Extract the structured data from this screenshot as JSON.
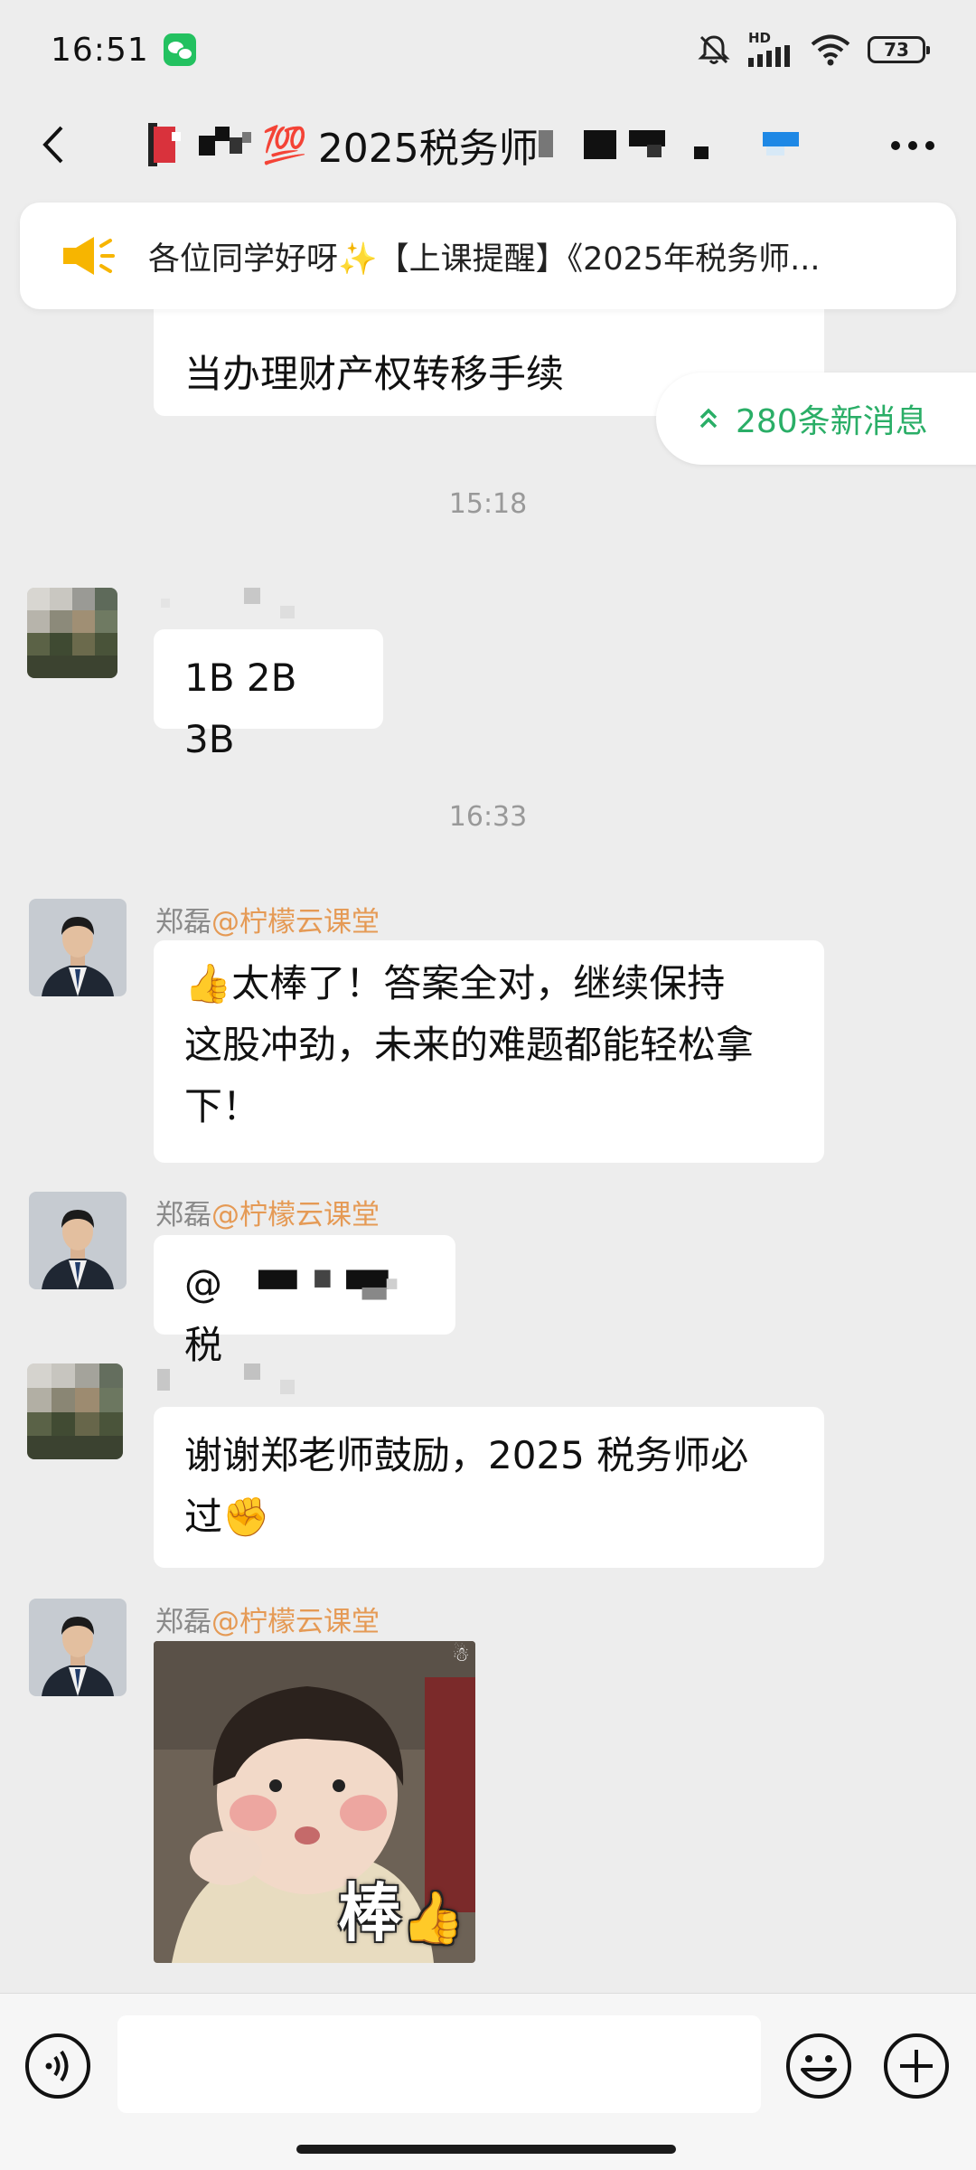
{
  "status_bar": {
    "time": "16:51",
    "network_label": "HD",
    "battery_level": "73"
  },
  "header": {
    "title_text": "2025税务师",
    "title_emoji": "💯"
  },
  "announcement": {
    "text": "各位同学好呀✨【上课提醒】《2025年税务师..."
  },
  "new_messages": {
    "label": "280条新消息"
  },
  "messages": [
    {
      "type": "text",
      "text": "当办理财产权转移手续"
    },
    {
      "type": "time",
      "text": "15:18"
    },
    {
      "type": "text",
      "text": "1B 2B 3B"
    },
    {
      "type": "time",
      "text": "16:33"
    },
    {
      "type": "text",
      "sender": "郑磊",
      "sender_org": "@柠檬云课堂",
      "emoji": "👍",
      "text_lines": [
        "太棒了！答案全对，继续保持",
        "这股冲劲，未来的难题都能轻松拿",
        "下！"
      ]
    },
    {
      "type": "text",
      "sender": "郑磊",
      "sender_org": "@柠檬云课堂",
      "text": "@税"
    },
    {
      "type": "text",
      "text_lines": [
        "谢谢郑老师鼓励，2025 税务师必",
        "过"
      ],
      "emoji": "✊"
    },
    {
      "type": "sticker",
      "sender": "郑磊",
      "sender_org": "@柠檬云课堂",
      "caption": "棒",
      "caption_emoji": "👍"
    }
  ],
  "colors": {
    "accent_green": "#2aae67",
    "sender_org": "#e59a55",
    "background": "#ededed"
  },
  "icons": [
    "back-icon",
    "more-icon",
    "megaphone-icon",
    "voice-icon",
    "emoji-icon",
    "plus-icon",
    "mute-bell-icon",
    "signal-icon",
    "wifi-icon"
  ]
}
